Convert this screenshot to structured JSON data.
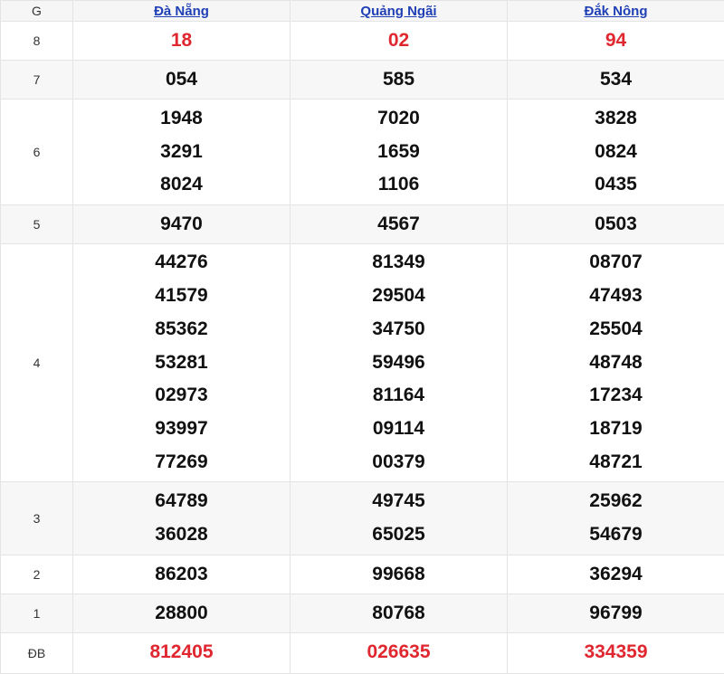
{
  "header": {
    "g_label": "G",
    "provinces": [
      "Đà Nẵng",
      "Quảng Ngãi",
      "Đắk Nông"
    ]
  },
  "colors": {
    "link": "#1f3fb5",
    "highlight": "#e0272f",
    "text": "#111111"
  },
  "rows": [
    {
      "prize": "8",
      "cells": [
        [
          "18"
        ],
        [
          "02"
        ],
        [
          "94"
        ]
      ]
    },
    {
      "prize": "7",
      "cells": [
        [
          "054"
        ],
        [
          "585"
        ],
        [
          "534"
        ]
      ]
    },
    {
      "prize": "6",
      "cells": [
        [
          "1948",
          "3291",
          "8024"
        ],
        [
          "7020",
          "1659",
          "1106"
        ],
        [
          "3828",
          "0824",
          "0435"
        ]
      ]
    },
    {
      "prize": "5",
      "cells": [
        [
          "9470"
        ],
        [
          "4567"
        ],
        [
          "0503"
        ]
      ]
    },
    {
      "prize": "4",
      "cells": [
        [
          "44276",
          "41579",
          "85362",
          "53281",
          "02973",
          "93997",
          "77269"
        ],
        [
          "81349",
          "29504",
          "34750",
          "59496",
          "81164",
          "09114",
          "00379"
        ],
        [
          "08707",
          "47493",
          "25504",
          "48748",
          "17234",
          "18719",
          "48721"
        ]
      ]
    },
    {
      "prize": "3",
      "cells": [
        [
          "64789",
          "36028"
        ],
        [
          "49745",
          "65025"
        ],
        [
          "25962",
          "54679"
        ]
      ]
    },
    {
      "prize": "2",
      "cells": [
        [
          "86203"
        ],
        [
          "99668"
        ],
        [
          "36294"
        ]
      ]
    },
    {
      "prize": "1",
      "cells": [
        [
          "28800"
        ],
        [
          "80768"
        ],
        [
          "96799"
        ]
      ]
    },
    {
      "prize": "ĐB",
      "cells": [
        [
          "812405"
        ],
        [
          "026635"
        ],
        [
          "334359"
        ]
      ]
    }
  ]
}
